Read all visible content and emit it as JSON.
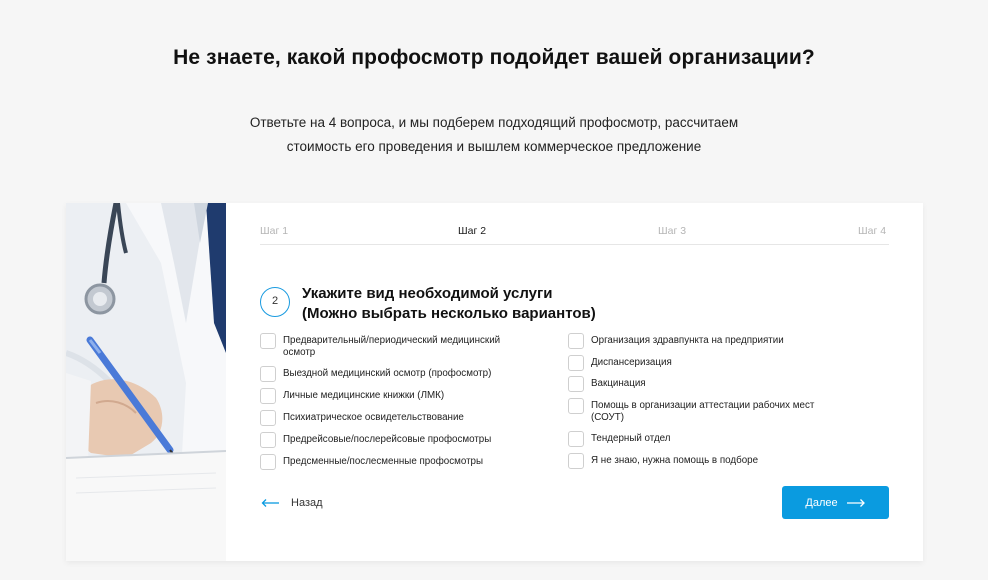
{
  "header": {
    "title": "Не знаете, какой профосмотр подойдет вашей организации?",
    "subtitle_line1": "Ответьте на 4 вопроса, и мы подберем подходящий профосмотр, рассчитаем",
    "subtitle_line2": "стоимость его проведения и вышлем коммерческое предложение"
  },
  "steps": [
    {
      "label": "Шаг 1",
      "active": false
    },
    {
      "label": "Шаг 2",
      "active": true
    },
    {
      "label": "Шаг 3",
      "active": false
    },
    {
      "label": "Шаг 4",
      "active": false
    }
  ],
  "question": {
    "number": "2",
    "title_line1": "Укажите вид необходимой услуги",
    "title_line2": "(Можно выбрать несколько вариантов)"
  },
  "options_left": [
    {
      "line1": "Предварительный/периодический медицинский",
      "line2": "осмотр",
      "checked": false
    },
    {
      "line1": "Выездной медицинский осмотр (профосмотр)",
      "line2": "",
      "checked": false
    },
    {
      "line1": "Личные медицинские книжки (ЛМК)",
      "line2": "",
      "checked": false
    },
    {
      "line1": "Психиатрическое освидетельствование",
      "line2": "",
      "checked": false
    },
    {
      "line1": "Предрейсовые/послерейсовые профосмотры",
      "line2": "",
      "checked": false
    },
    {
      "line1": "Предсменные/послесменные профосмотры",
      "line2": "",
      "checked": false
    }
  ],
  "options_right": [
    {
      "line1": "Организация здравпункта на предприятии",
      "line2": "",
      "checked": false
    },
    {
      "line1": "Диспансеризация",
      "line2": "",
      "checked": false
    },
    {
      "line1": "Вакцинация",
      "line2": "",
      "checked": false
    },
    {
      "line1": "Помощь в организации аттестации рабочих мест",
      "line2": "(СОУТ)",
      "checked": false
    },
    {
      "line1": "Тендерный отдел",
      "line2": "",
      "checked": false
    },
    {
      "line1": "Я не знаю, нужна помощь в подборе",
      "line2": "",
      "checked": false
    }
  ],
  "nav": {
    "back_label": "Назад",
    "next_label": "Далее"
  },
  "colors": {
    "accent": "#0a9be0",
    "step_inactive": "#b5b5b5",
    "background": "#f6f6f6"
  },
  "icons": {
    "back": "arrow-left-icon",
    "next": "arrow-right-icon"
  }
}
